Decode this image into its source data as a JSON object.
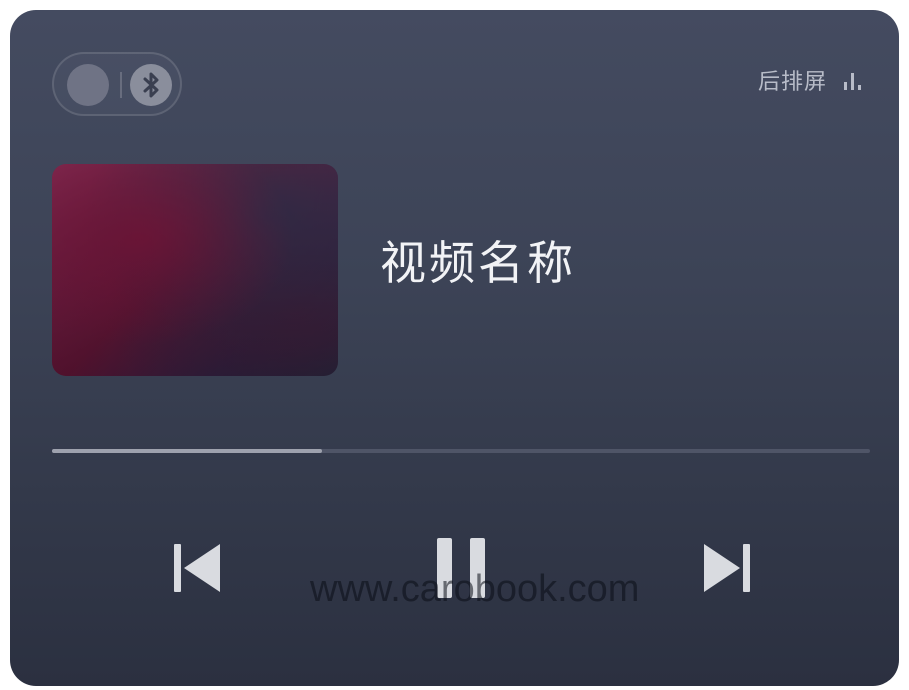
{
  "header": {
    "rear_screen_label": "后排屏",
    "source_icons": [
      "toggle-dot-icon",
      "bluetooth-icon"
    ],
    "right_icon": "audio-bars-icon"
  },
  "media": {
    "title": "视频名称",
    "progress": 0.33
  },
  "controls": {
    "icons": [
      "skip-previous-icon",
      "pause-icon",
      "skip-next-icon"
    ]
  },
  "watermark": {
    "text": "www.carobook.com"
  },
  "colors": {
    "card_top": "#444b60",
    "card_bottom": "#2b3040",
    "progress_fill": "#9ea2ae",
    "progress_track": "#4f5567",
    "icon": "#d9dbe0"
  }
}
